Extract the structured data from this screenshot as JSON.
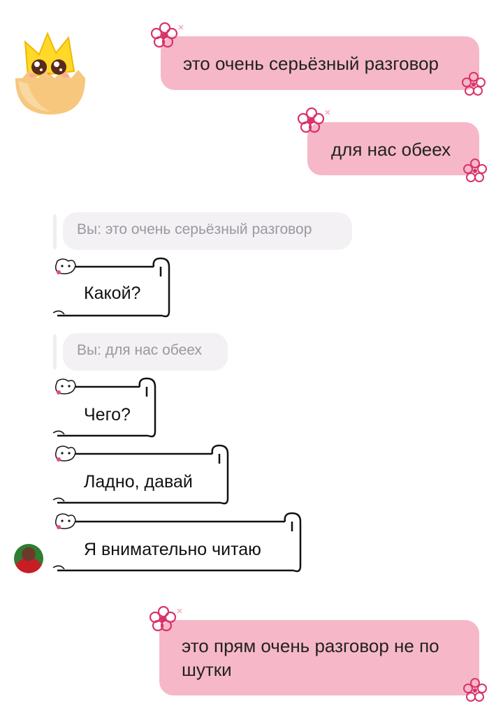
{
  "messages_out": [
    {
      "text": "это очень серьёзный разговор"
    },
    {
      "text": "для нас обеех"
    },
    {
      "text": "это прям очень разговор не по шутки"
    }
  ],
  "quotes": [
    {
      "text": "Вы: это очень серьёзный разговор"
    },
    {
      "text": "Вы: для нас обеех"
    }
  ],
  "messages_in": [
    {
      "text": "Какой?"
    },
    {
      "text": "Чего?"
    },
    {
      "text": "Ладно, давай"
    },
    {
      "text": "Я внимательно читаю"
    }
  ],
  "colors": {
    "outgoing_bubble": "#f6b8c8",
    "flower": "#d9336b",
    "quote_chip": "#f3f1f4",
    "quote_text": "#9a98a0"
  }
}
